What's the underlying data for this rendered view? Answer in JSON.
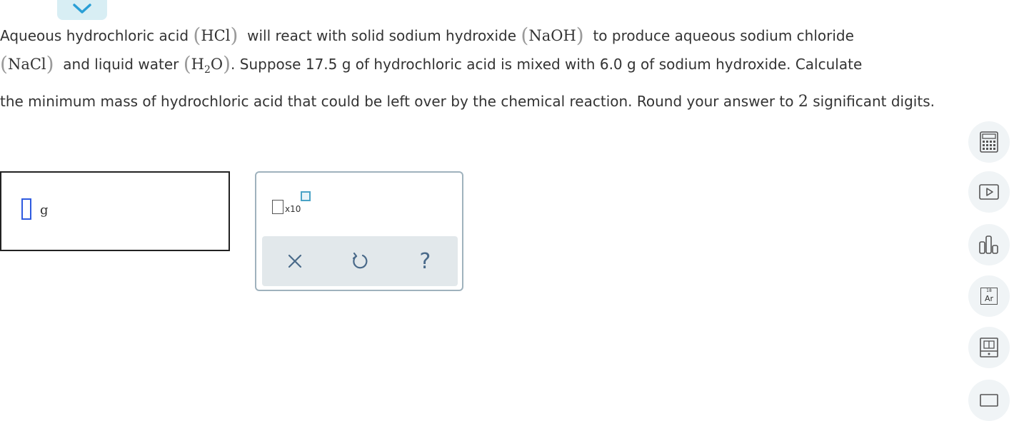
{
  "question": {
    "part1": "Aqueous hydrochloric acid",
    "hcl": "HCl",
    "part2": "will react with solid sodium hydroxide",
    "naoh": "NaOH",
    "part3": "to produce aqueous sodium chloride",
    "nacl": "NaCl",
    "part4": "and liquid water",
    "h2o_h": "H",
    "h2o_sub": "2",
    "h2o_o": "O",
    "part5": ". Suppose 17.5 g of hydrochloric acid is mixed with 6.0 g of sodium hydroxide. Calculate",
    "part6": "the minimum mass of hydrochloric acid that could be left over by the chemical reaction. Round your answer to",
    "sig_figs": "2",
    "part7": "significant digits."
  },
  "answer": {
    "unit": "g"
  },
  "palette": {
    "x10_label": "x10",
    "help_label": "?"
  },
  "tools": {
    "periodic_number": "18",
    "periodic_symbol": "Ar"
  },
  "colors": {
    "accent": "#2f5be0",
    "teal": "#4aa3c6",
    "tab": "#d8eef4",
    "palette_bar": "#e2e8eb"
  }
}
